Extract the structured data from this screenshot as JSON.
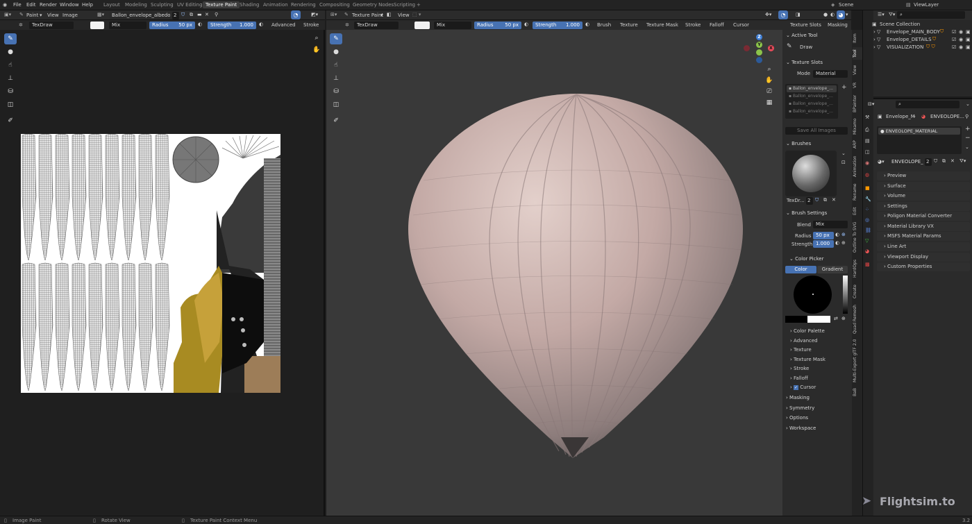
{
  "topbar": {
    "menus": [
      "File",
      "Edit",
      "Render",
      "Window",
      "Help"
    ],
    "workspaces": [
      "Layout",
      "Modeling",
      "Sculpting",
      "UV Editing",
      "Texture Paint",
      "Shading",
      "Animation",
      "Rendering",
      "Compositing",
      "Geometry Nodes",
      "Scripting"
    ],
    "add": "+",
    "scene": "Scene",
    "view_layer": "ViewLayer"
  },
  "image_editor": {
    "mode": "Paint",
    "menus": [
      "View",
      "Image"
    ],
    "image_name": "Ballon_envelope_albedo.png",
    "users": "2",
    "brush": "TexDraw",
    "blend": "Mix",
    "radius_label": "Radius",
    "radius": "50 px",
    "strength_label": "Strength",
    "strength": "1.000",
    "advanced": "Advanced",
    "stroke": "Stroke"
  },
  "viewport": {
    "mode": "Texture Paint",
    "menu": "View",
    "brush": "TexDraw",
    "blend": "Mix",
    "radius_label": "Radius",
    "radius": "50 px",
    "strength_label": "Strength",
    "strength": "1.000",
    "menus": [
      "Brush",
      "Texture",
      "Texture Mask",
      "Stroke",
      "Falloff",
      "Cursor"
    ],
    "texture_slots": "Texture Slots",
    "masking": "Masking",
    "gizmo": {
      "x": "X",
      "y": "Y",
      "z": "Z"
    }
  },
  "tool_panel": {
    "active_tool": "Active Tool",
    "draw": "Draw",
    "texture_slots": "Texture Slots",
    "mode_label": "Mode",
    "mode": "Material",
    "slots": [
      "Ballon_envelope_...",
      "Ballon_envelope_...",
      "Ballon_envelope_...",
      "Ballon_envelope_..."
    ],
    "save_all": "Save All Images",
    "brushes": "Brushes",
    "brush_name": "TexDr...",
    "brush_users": "2",
    "brush_settings": "Brush Settings",
    "blend_label": "Blend",
    "blend": "Mix",
    "radius_label": "Radius",
    "radius": "50 px",
    "strength_label": "Strength",
    "strength": "1.000",
    "color_picker": "Color Picker",
    "color_tab": "Color",
    "gradient_tab": "Gradient",
    "subpanels": [
      "Color Palette",
      "Advanced",
      "Texture",
      "Texture Mask",
      "Stroke",
      "Falloff",
      "Cursor"
    ],
    "sections": [
      "Masking",
      "Symmetry",
      "Options",
      "Workspace"
    ]
  },
  "side_tabs": [
    "Item",
    "Tool",
    "View",
    "VR",
    "BPainter",
    "Mixamo",
    "ARP",
    "Animation",
    "Rename",
    "Edit",
    "Outline To SVG",
    "HardOps",
    "Create",
    "Quad Remesh",
    "Multi-Export glTF 2.0",
    "BaB"
  ],
  "outliner": {
    "collection": "Scene Collection",
    "items": [
      "Envelope_MAIN_BODY",
      "Envelope_DETAILS",
      "VISUALIZATION"
    ]
  },
  "properties": {
    "object": "Envelope_M",
    "material_breadcrumb": "ENVEOLOPE...",
    "material_slot": "ENVEOLOPE_MATERIAL",
    "material_name": "ENVEOLOPE_...",
    "material_users": "2",
    "rows": [
      "Preview",
      "Surface",
      "Volume",
      "Settings",
      "Poligon Material Converter",
      "Material Library VX",
      "MSFS Material Params",
      "Line Art",
      "Viewport Display",
      "Custom Properties"
    ]
  },
  "statusbar": {
    "items": [
      "Image Paint",
      "Rotate View",
      "Texture Paint Context Menu"
    ],
    "version": "3.2"
  },
  "watermark": "Flightsim.to",
  "colors": {
    "accent": "#4772b3",
    "balloon": "#c9b3ae"
  }
}
